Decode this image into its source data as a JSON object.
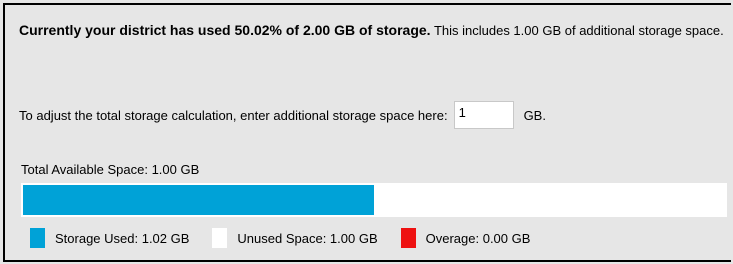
{
  "summary": {
    "bold_text": "Currently your district has used 50.02% of 2.00 GB of storage.",
    "normal_text": " This includes 1.00 GB of additional storage space."
  },
  "adjust": {
    "label": "To adjust the total storage calculation, enter additional storage space here:",
    "value": "1",
    "unit": "GB."
  },
  "total": {
    "label": "Total Available Space: 1.00 GB"
  },
  "usage_bar": {
    "used_fraction": 0.5002,
    "used_color": "#00a2d7",
    "unused_color": "#ffffff",
    "overage_color": "#ee1111"
  },
  "legend": {
    "used": "Storage Used: 1.02 GB",
    "unused": "Unused Space: 1.00 GB",
    "overage": "Overage: 0.00 GB"
  }
}
